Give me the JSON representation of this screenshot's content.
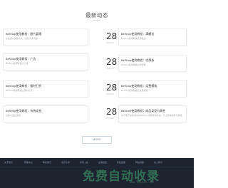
{
  "section": {
    "title": "最新动态",
    "more_label": "MORE"
  },
  "news_left": [
    {
      "title": "BirShop使用教程：图片管理",
      "desc": "在使用以前的方式，会有许多问题..."
    },
    {
      "title": "BirShop使用教程：广告",
      "desc": "BirShop使用教程之广告..."
    },
    {
      "title": "BirShop使用教程：限时打折",
      "desc": "BirShop使用教程之限时打折..."
    },
    {
      "title": "BirShop使用教程：系统文档",
      "desc": "系统文档的使用..."
    }
  ],
  "news_right": [
    {
      "day": "28",
      "ym": "2020-07",
      "title": "BirShop使用教程：满额送",
      "desc": "BirShop使用教程之满额送..."
    },
    {
      "day": "28",
      "ym": "2020-07",
      "title": "BirShop使用教程：优惠券",
      "desc": "BirShop使用教程之优惠券..."
    },
    {
      "day": "28",
      "ym": "2020-07",
      "title": "BirShop使用教程：运费模板",
      "desc": "BirShop使用教程之运费模板..."
    },
    {
      "day": "28",
      "ym": "2020-07",
      "title": "BirShop使用教程：商品类型与属性",
      "desc": "关于属于最新发布的BirShop当前使用状态，可入系统类型与属性..."
    }
  ],
  "footer": {
    "nav": [
      "关于我们",
      "帮助中心",
      "联系我们",
      "合作伙伴",
      "商家入驻",
      "友情链接",
      "隐私政策",
      "网站地图",
      "加入我们"
    ],
    "watermark": "免费自动收录",
    "watermark_url": "www.xxxxxx.com"
  },
  "colors": {
    "footer_bg": "#1c2430",
    "watermark": "#46aa73"
  }
}
